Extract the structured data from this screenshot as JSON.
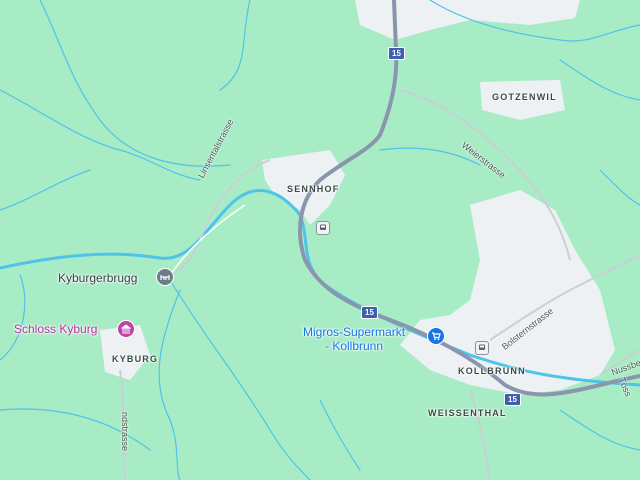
{
  "map": {
    "colors": {
      "land": "#a8ecc6",
      "water": "#4fc3ea",
      "highway": "#8a96ad",
      "road": "#ffffff",
      "minor_road": "#c9cfd3",
      "urban": "#eef1f4"
    },
    "places": {
      "gotzenwil": "GOTZENWIL",
      "sennhof": "SENNHOF",
      "kyburg": "KYBURG",
      "kollbrunn": "KOLLBRUNN",
      "weissenthal": "WEISSENTHAL"
    },
    "streets": {
      "linsentalstrasse": "Linsentalstrasse",
      "weierstrasse": "Weierstrasse",
      "bolsternstrasse": "Bolsternstrasse",
      "nussberg": "Nussbe",
      "tossstrasse": "Töss",
      "kyburg_road": "ndstrasse"
    },
    "pois": {
      "kyburgerbrugg": "Kyburgerbrugg",
      "schloss_kyburg": "Schloss Kyburg",
      "migros_line1": "Migros-Supermarkt",
      "migros_line2": "- Kollbrunn"
    },
    "route_number": "15",
    "icons": {
      "bridge": "bridge-icon",
      "castle": "museum-icon",
      "shop": "shopping-cart-icon",
      "station": "train-station-icon"
    }
  }
}
